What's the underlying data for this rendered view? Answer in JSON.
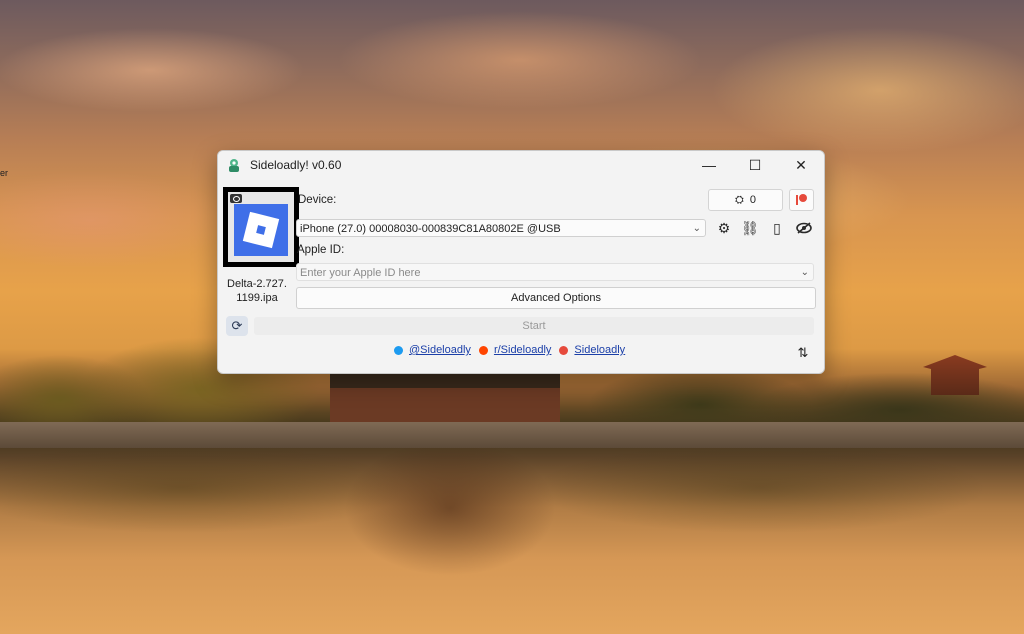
{
  "window": {
    "title": "Sideloadly! v0.60",
    "minimize_glyph": "—",
    "maximize_glyph": "☐",
    "close_glyph": "✕"
  },
  "ipa": {
    "file_name": "Delta-2.727. 1199.ipa",
    "tile_color": "#3f6fe8"
  },
  "device": {
    "label": "Device:",
    "selected": "iPhone (27.0) 00008030-000839C81A80802E @USB",
    "counter_value": "0"
  },
  "apple_id": {
    "label": "Apple ID:",
    "placeholder": "Enter your Apple ID here"
  },
  "buttons": {
    "advanced_options": "Advanced Options",
    "start": "Start"
  },
  "links": {
    "twitter": "@Sideloadly",
    "reddit": "r/Sideloadly",
    "patreon": "Sideloadly"
  },
  "icons": {
    "gear": "⚙",
    "link": "⛓",
    "phone": "▯",
    "eye": "◎",
    "refresh": "⟳",
    "sort": "⇅",
    "counter": "⛭"
  },
  "colors": {
    "accent": "#1b3fa8",
    "patreon": "#e64a3c",
    "twitter": "#1d9bf0",
    "reddit": "#ff4500"
  },
  "desktop_edge_text": "er"
}
